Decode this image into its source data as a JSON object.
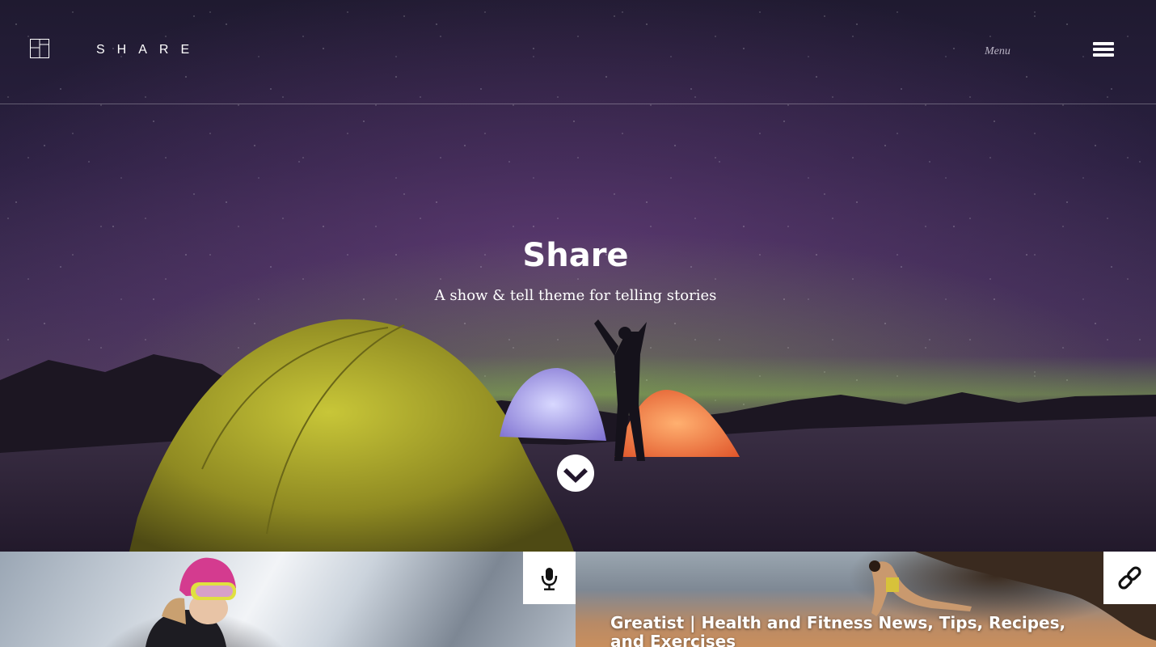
{
  "header": {
    "site_name": "SHARE",
    "menu_label": "Menu"
  },
  "hero": {
    "title": "Share",
    "tagline": "A show & tell theme for telling stories"
  },
  "cards": [
    {
      "type_icon": "microphone-icon",
      "title": ""
    },
    {
      "type_icon": "link-icon",
      "title": "Greatist | Health and Fitness News, Tips, Recipes, and Exercises"
    }
  ],
  "colors": {
    "header_text": "#ffffff",
    "menu_label": "#b9b3c4",
    "card_icon_bg": "#ffffff"
  }
}
